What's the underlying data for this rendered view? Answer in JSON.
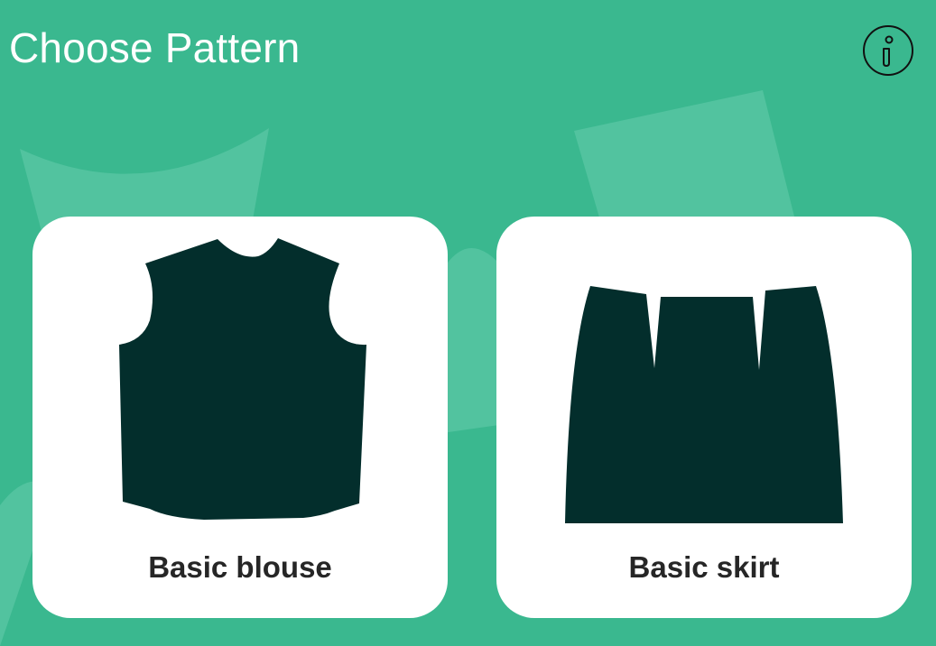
{
  "header": {
    "title": "Choose Pattern"
  },
  "icons": {
    "info": "info-icon",
    "blouse": "blouse-pattern-icon",
    "skirt": "skirt-pattern-icon"
  },
  "patterns": [
    {
      "label": "Basic blouse"
    },
    {
      "label": "Basic skirt"
    }
  ],
  "colors": {
    "background": "#3ab88f",
    "background_shape": "#52c39f",
    "card": "#ffffff",
    "pattern_fill": "#032e2c",
    "label_text": "#262626"
  }
}
